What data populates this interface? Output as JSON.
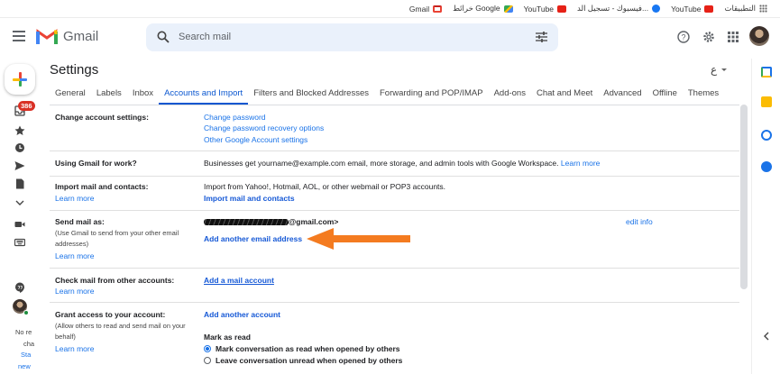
{
  "bookmarks": {
    "items": [
      {
        "label": "Gmail",
        "icon": "gmail-icon"
      },
      {
        "label": "خرائط Google",
        "icon": "maps-icon"
      },
      {
        "label": "YouTube",
        "icon": "youtube-icon"
      },
      {
        "label": "فيسبوك - تسجيل الد...",
        "icon": "facebook-icon"
      },
      {
        "label": "YouTube",
        "icon": "youtube-icon"
      },
      {
        "label": "التطبيقات",
        "icon": "apps-icon"
      }
    ]
  },
  "header": {
    "app_name": "Gmail",
    "search_placeholder": "Search mail"
  },
  "rail": {
    "badge_count": "386",
    "chat_text": [
      "No re",
      "cha",
      "Sta",
      "new"
    ]
  },
  "settings": {
    "title": "Settings",
    "lang_indicator": "ع",
    "tabs": [
      {
        "label": "General"
      },
      {
        "label": "Labels"
      },
      {
        "label": "Inbox"
      },
      {
        "label": "Accounts and Import"
      },
      {
        "label": "Filters and Blocked Addresses"
      },
      {
        "label": "Forwarding and POP/IMAP"
      },
      {
        "label": "Add-ons"
      },
      {
        "label": "Chat and Meet"
      },
      {
        "label": "Advanced"
      },
      {
        "label": "Offline"
      },
      {
        "label": "Themes"
      }
    ],
    "active_tab": "Accounts and Import",
    "rows": {
      "change_account": {
        "label": "Change account settings:",
        "links": [
          "Change password",
          "Change password recovery options",
          "Other Google Account settings"
        ]
      },
      "work": {
        "label": "Using Gmail for work?",
        "text": "Businesses get yourname@example.com email, more storage, and admin tools with Google Workspace.",
        "link": "Learn more"
      },
      "import": {
        "label": "Import mail and contacts:",
        "learn_more": "Learn more",
        "text": "Import from Yahoo!, Hotmail, AOL, or other webmail or POP3 accounts.",
        "action": "Import mail and contacts"
      },
      "send_as": {
        "label": "Send mail as:",
        "sub": "(Use Gmail to send from your other email addresses)",
        "learn_more": "Learn more",
        "email_suffix": "@gmail.com>",
        "edit": "edit info",
        "action": "Add another email address"
      },
      "check_mail": {
        "label": "Check mail from other accounts:",
        "learn_more": "Learn more",
        "action": "Add a mail account"
      },
      "grant": {
        "label": "Grant access to your account:",
        "sub": "(Allow others to read and send mail on your behalf)",
        "learn_more": "Learn more",
        "action": "Add another account",
        "mark_title": "Mark as read",
        "options": [
          "Mark conversation as read when opened by others",
          "Leave conversation unread when opened by others"
        ]
      }
    }
  },
  "colors": {
    "accent": "#0b57d0",
    "link": "#1a73e8",
    "arrow": "#f47b20",
    "badge": "#d93025"
  }
}
